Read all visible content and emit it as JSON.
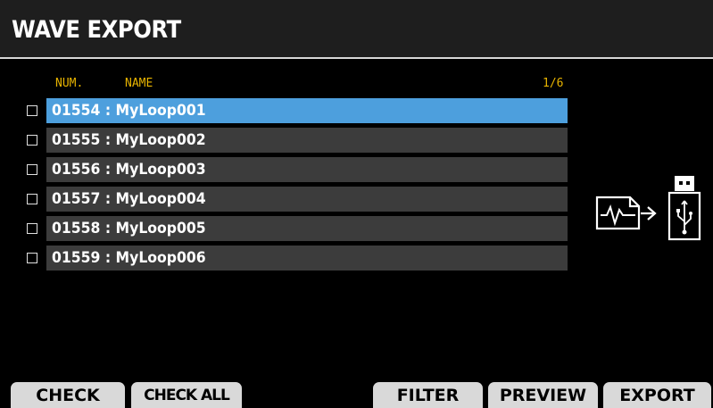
{
  "title": "WAVE EXPORT",
  "list": {
    "col_num": "NUM.",
    "col_name": "NAME",
    "page": "1/6",
    "rows": [
      {
        "label": "01554 : MyLoop001",
        "checked": false,
        "selected": true
      },
      {
        "label": "01555 : MyLoop002",
        "checked": false,
        "selected": false
      },
      {
        "label": "01556 : MyLoop003",
        "checked": false,
        "selected": false
      },
      {
        "label": "01557 : MyLoop004",
        "checked": false,
        "selected": false
      },
      {
        "label": "01558 : MyLoop005",
        "checked": false,
        "selected": false
      },
      {
        "label": "01559 : MyLoop006",
        "checked": false,
        "selected": false
      }
    ]
  },
  "export_icon": "wave-to-usb-icon",
  "buttons": {
    "check": "CHECK",
    "check_all": "CHECK ALL",
    "filter": "FILTER",
    "preview": "PREVIEW",
    "export": "EXPORT"
  },
  "colors": {
    "accent": "#e8b400",
    "selection": "#4d9fdd",
    "row": "#3c3c3c"
  }
}
